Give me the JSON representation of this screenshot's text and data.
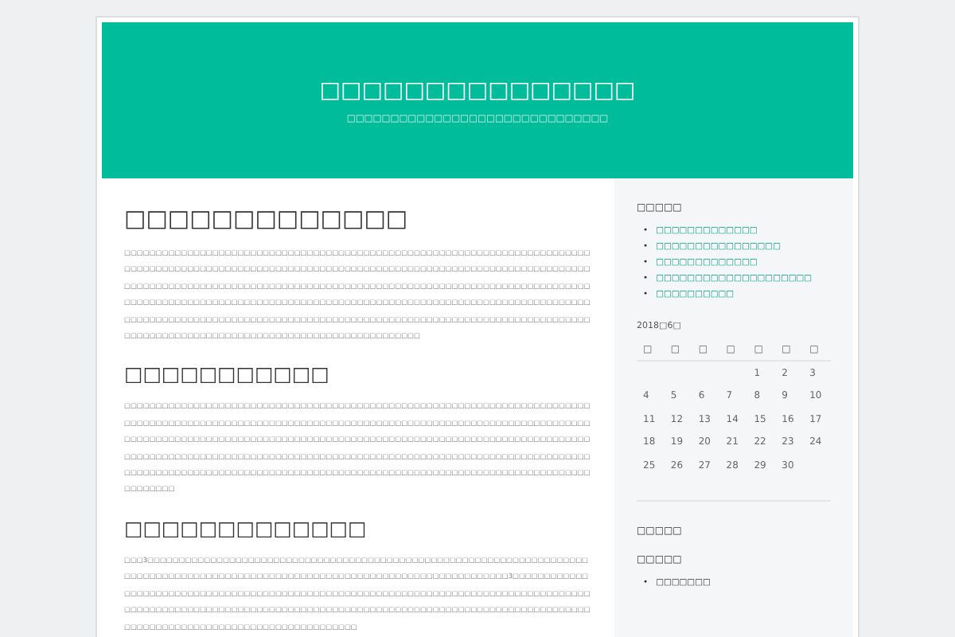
{
  "header": {
    "title": "□□□□□□□□□□□□□□□",
    "tagline": "□□□□□□□□□□□□□□□□□□□□□□□□□□□□□□"
  },
  "article": {
    "title": "□□□□□□□□□□□□□",
    "blocks": [
      {
        "kind": "paragraph",
        "text": "□□□□□□□□□□□□□□□□□□□□□□□□□□□□□□□□□□□□□□□□□□□□□□□□□□□□□□□□□□□□□□□□□□□□□□□□□□□□□□□□□□□□□□□□□□□□□□□□□□□□□□□□□□□□□□□□□□□□□□□□□□□□□□□□□□□□□□□□□□□□□□□□□□□□□□□□□□□□□□□□□□□□□□□□□□□□□□□□□□□□□□□□□□□□□□□□□□□□□□□□□□□□□□□□□□□□□□□□□□□□□□□□□□□□□□□□□□□□□□□□□□□□□□□□□□□□□□□□□□□□□□□□□□□□□□□□□□□□□□□□□□□□□□□□□□□□□□□□□□□□□□□□□□□□□□□□□□□□□□□□□□□□□□□□□□□□□□□□□□□□□□□□□□□□□□□□□□□□□□□□□□□□□□□□□□□□□□□□□□□□□□□□□□□□□□□□□□□□□□□□□□□□□□□□□□□□□□□□□"
      },
      {
        "kind": "heading",
        "text": "□□□□□□□□□□□"
      },
      {
        "kind": "paragraph",
        "text": "□□□□□□□□□□□□□□□□□□□□□□□□□□□□□□□□□□□□□□□□□□□□□□□□□□□□□□□□□□□□□□□□□□□□□□□□□□□□□□□□□□□□□□□□□□□□□□□□□□□□□□□□□□□□□□□□□□□□□□□□□□□□□□□□□□□□□□□□□□□□□□□□□□□□□□□□□□□□□□□□□□□□□□□□□□□□□□□□□□□□□□□□□□□□□□□□□□□□□□□□□□□□□□□□□□□□□□□□□□□□□□□□□□□□□□□□□□□□□□□□□□□□□□□□□□□□□□□□□□□□□□□□□□□□□□□□□□□□□□□□□□□□□□□□□□□□□□□□□□□□□□□□□□□□□□□□□□□□□□□□□□□□□□□□□□□□□□□□□□□□□□□□□□□□□□□□□□□□□□□□□□□□□□□□□□□□□□□□□□"
      },
      {
        "kind": "heading",
        "text": "□□□□□□□□□□□□□"
      },
      {
        "kind": "paragraph",
        "text": "□□□3□□□□□□□□□□□□□□□□□□□□□□□□□□□□□□□□□□□□□□□□□□□□□□□□□□□□□□□□□□□□□□□□□□□□□□□□□□□□□□□□□□□□□□□□□□□□□□□□□□□□□□□□□□□□□□□□□□□□□□□□□□□□□□□□□□□3□□□□□□□□□□□□□□□□□□□□□□□□□□□□□□□□□□□□□□□□□□□□□□□□□□□□□□□□□□□□□□□□□□□□□□□□□□□□□□□□□□□□□□□□□□□□□□□□□□□□□□□□□□□□□□□□□□□□□□□□□□□□□□□□□□□□□□□□□□□□□□□□□□□□□□□□□□□□□□□□□□□□□□□□□□□□□□□□□□□□□□□□□□□□□□□□□□□□□"
      }
    ]
  },
  "sidebar": {
    "widgets": [
      {
        "kind": "links",
        "title": "□□□□□",
        "marker": "•",
        "items": [
          "□□□□□□□□□□□□□",
          "□□□□□□□□□□□□□□□□",
          "□□□□□□□□□□□□□",
          "□□□□□□□□□□□□□□□□□□□□",
          "□□□□□□□□□□"
        ]
      },
      {
        "kind": "calendar",
        "caption": "2018□6□",
        "weekdays": [
          "□",
          "□",
          "□",
          "□",
          "□",
          "□",
          "□"
        ],
        "weeks": [
          {
            "kind": "first",
            "days": [
              "1",
              "2",
              "3"
            ]
          },
          {
            "kind": "full",
            "days": [
              "4",
              "5",
              "6",
              "7",
              "8",
              "9",
              "10"
            ]
          },
          {
            "kind": "full",
            "days": [
              "11",
              "12",
              "13",
              "14",
              "15",
              "16",
              "17"
            ]
          },
          {
            "kind": "full",
            "days": [
              "18",
              "19",
              "20",
              "21",
              "22",
              "23",
              "24"
            ]
          },
          {
            "kind": "last",
            "days": [
              "25",
              "26",
              "27",
              "28",
              "29",
              "30"
            ]
          }
        ]
      },
      {
        "kind": "heading",
        "title": "□□□□□"
      },
      {
        "kind": "list",
        "title": "□□□□□",
        "marker": "•",
        "items": [
          "□□□□□□□"
        ]
      }
    ]
  }
}
